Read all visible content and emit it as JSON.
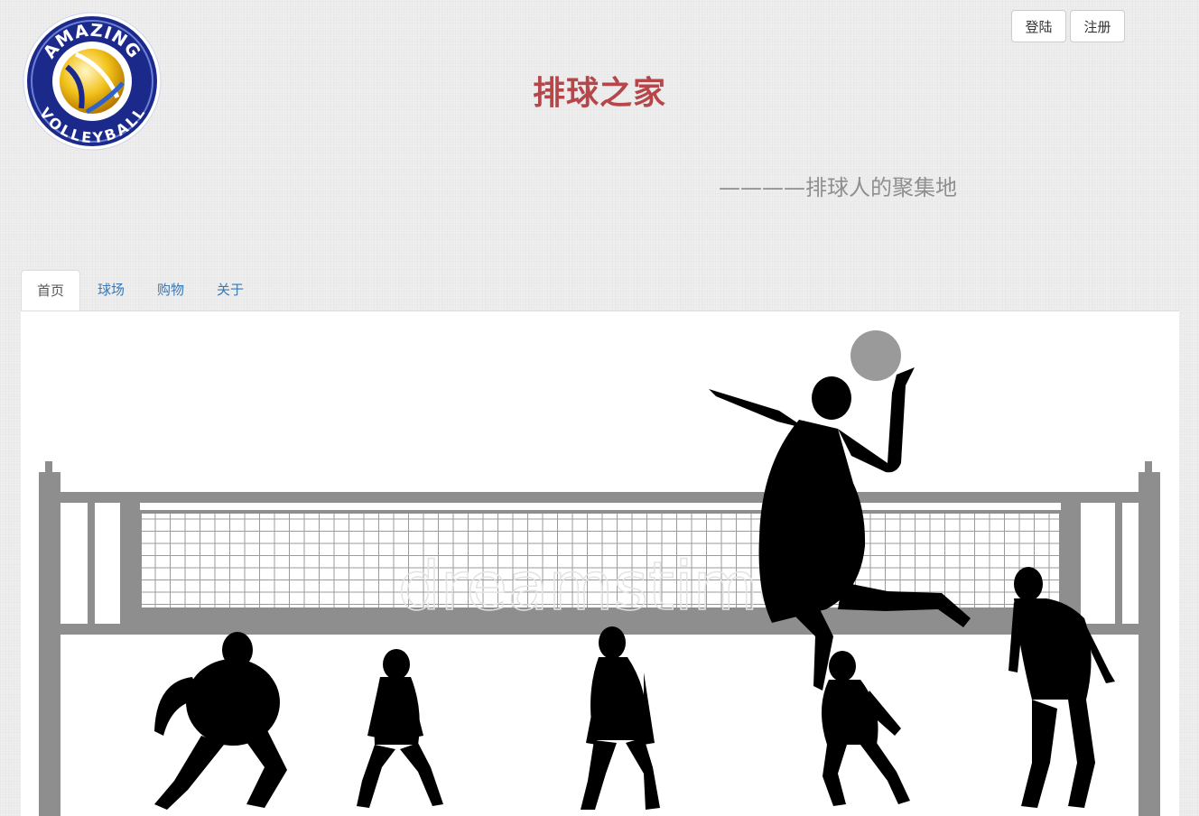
{
  "header": {
    "logo_text_top": "AMAZING",
    "logo_text_bottom": "VOLLEYBALL",
    "title": "排球之家",
    "subtitle": "————排球人的聚集地"
  },
  "auth": {
    "login_label": "登陆",
    "register_label": "注册"
  },
  "nav": {
    "tabs": [
      {
        "label": "首页",
        "active": true
      },
      {
        "label": "球场",
        "active": false
      },
      {
        "label": "购物",
        "active": false
      },
      {
        "label": "关于",
        "active": false
      }
    ]
  },
  "banner": {
    "watermark": "dreamstime"
  },
  "colors": {
    "title": "#b5474b",
    "link": "#3a78b5",
    "net_gray": "#8e8e8e"
  }
}
